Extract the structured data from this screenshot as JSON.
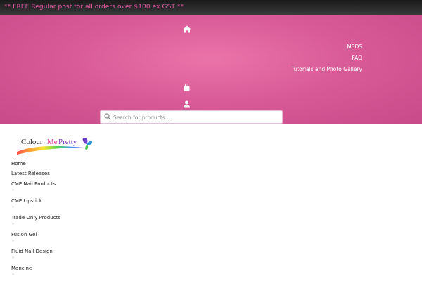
{
  "promo_bar": {
    "text": "** FREE Regular post for all orders over $100 ex GST **"
  },
  "header": {
    "icons": [
      "home-icon",
      "shopping-bag-icon",
      "user-icon"
    ],
    "menu": [
      "MSDS",
      "FAQ",
      "Tutorials and Photo Gallery"
    ]
  },
  "search": {
    "placeholder": "Search for products..."
  },
  "logo": {
    "text_colour": "Colour",
    "text_me": "Me",
    "text_pretty": "Pretty"
  },
  "nav": {
    "items": [
      "Home",
      "Latest Releases",
      "CMP Nail Products",
      "CMP Lipstick",
      "Trade Only Products",
      "Fusion Gel",
      "Fluid Nail Design",
      "Mancine"
    ],
    "submenu_caret": "»"
  },
  "colors": {
    "accent_pink": "#e85aa6",
    "header_pink": "#d95c98",
    "topbar_dark": "#2a2a2a"
  }
}
